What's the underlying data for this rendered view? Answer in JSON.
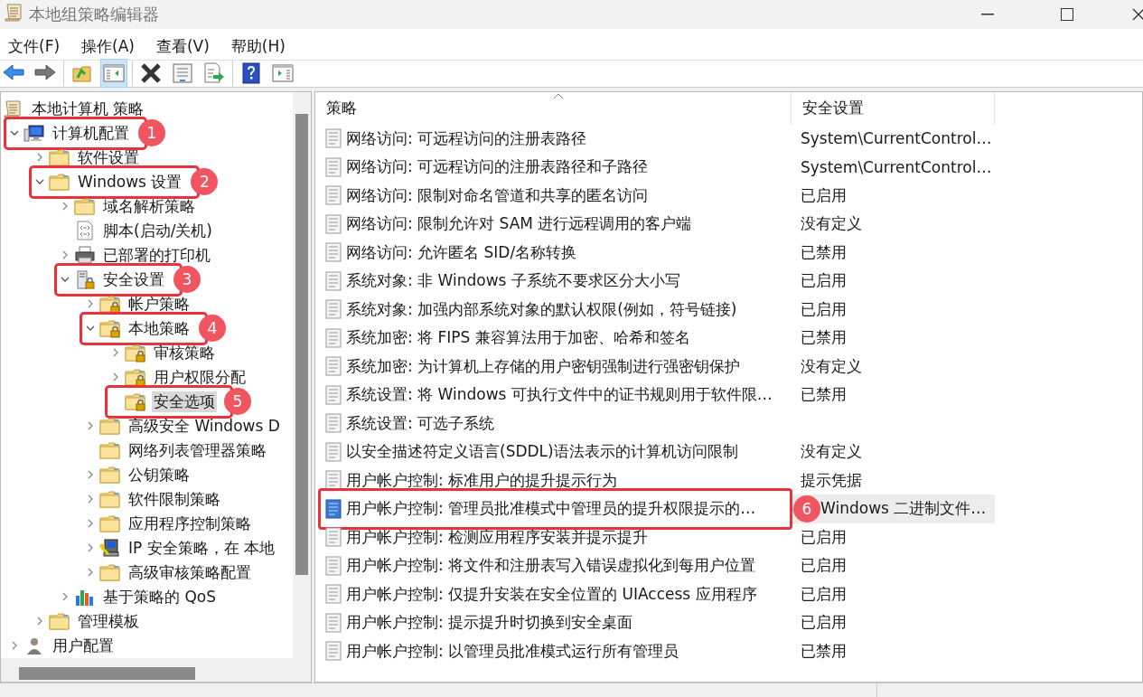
{
  "window": {
    "title": "本地组策略编辑器"
  },
  "menu": [
    {
      "label": "文件(F)"
    },
    {
      "label": "操作(A)"
    },
    {
      "label": "查看(V)"
    },
    {
      "label": "帮助(H)"
    }
  ],
  "toolbar": [
    [
      {
        "kind": "back",
        "pressed": false
      },
      {
        "kind": "forward",
        "pressed": false
      }
    ],
    [
      {
        "kind": "up",
        "pressed": false
      },
      {
        "kind": "tree",
        "pressed": true
      }
    ],
    [
      {
        "kind": "delete",
        "pressed": false
      },
      {
        "kind": "properties",
        "pressed": false
      },
      {
        "kind": "export",
        "pressed": false
      }
    ],
    [
      {
        "kind": "help",
        "pressed": false
      },
      {
        "kind": "actions",
        "pressed": false
      }
    ]
  ],
  "tree": [
    {
      "label": "本地计算机 策略",
      "kind": "scroll",
      "selected": false,
      "children": [
        {
          "label": "计算机配置",
          "kind": "computer",
          "expanded": true,
          "selected": false,
          "callout": "1",
          "children": [
            {
              "label": "软件设置",
              "kind": "folder",
              "expanded": false,
              "selected": false
            },
            {
              "label": "Windows 设置",
              "kind": "folder",
              "expanded": true,
              "selected": false,
              "callout": "2",
              "children": [
                {
                  "label": "域名解析策略",
                  "kind": "folder",
                  "expanded": false,
                  "selected": false
                },
                {
                  "label": "脚本(启动/关机)",
                  "kind": "script",
                  "selected": false
                },
                {
                  "label": "已部署的打印机",
                  "kind": "printer",
                  "expanded": false,
                  "selected": false
                },
                {
                  "label": "安全设置",
                  "kind": "server",
                  "expanded": true,
                  "selected": false,
                  "callout": "3",
                  "children": [
                    {
                      "label": "帐户策略",
                      "kind": "secure",
                      "expanded": false,
                      "selected": false
                    },
                    {
                      "label": "本地策略",
                      "kind": "secure",
                      "expanded": true,
                      "selected": false,
                      "callout": "4",
                      "children": [
                        {
                          "label": "审核策略",
                          "kind": "secure",
                          "expanded": false,
                          "selected": false
                        },
                        {
                          "label": "用户权限分配",
                          "kind": "secure",
                          "expanded": false,
                          "selected": false
                        },
                        {
                          "label": "安全选项",
                          "kind": "secure",
                          "selected": true,
                          "callout": "5"
                        }
                      ]
                    },
                    {
                      "label": "高级安全 Windows D",
                      "kind": "folder",
                      "expanded": false,
                      "selected": false
                    },
                    {
                      "label": "网络列表管理器策略",
                      "kind": "folder",
                      "selected": false
                    },
                    {
                      "label": "公钥策略",
                      "kind": "folder",
                      "expanded": false,
                      "selected": false
                    },
                    {
                      "label": "软件限制策略",
                      "kind": "folder",
                      "expanded": false,
                      "selected": false
                    },
                    {
                      "label": "应用程序控制策略",
                      "kind": "folder",
                      "expanded": false,
                      "selected": false
                    },
                    {
                      "label": "IP 安全策略，在 本地",
                      "kind": "ip",
                      "expanded": false,
                      "selected": false
                    },
                    {
                      "label": "高级审核策略配置",
                      "kind": "folder",
                      "expanded": false,
                      "selected": false
                    }
                  ]
                },
                {
                  "label": "基于策略的 QoS",
                  "kind": "qos",
                  "expanded": false,
                  "selected": false
                }
              ]
            },
            {
              "label": "管理模板",
              "kind": "folder",
              "expanded": false,
              "selected": false
            }
          ]
        },
        {
          "label": "用户配置",
          "kind": "user",
          "expanded": false,
          "selected": false
        }
      ]
    }
  ],
  "table": {
    "columns": [
      {
        "label": "策略",
        "sorted": true
      },
      {
        "label": "安全设置",
        "sorted": false
      }
    ],
    "rows": [
      {
        "policy": "网络访问: 可远程访问的注册表路径",
        "setting": "System\\CurrentControl…",
        "selected": false
      },
      {
        "policy": "网络访问: 可远程访问的注册表路径和子路径",
        "setting": "System\\CurrentControl…",
        "selected": false
      },
      {
        "policy": "网络访问: 限制对命名管道和共享的匿名访问",
        "setting": "已启用",
        "selected": false
      },
      {
        "policy": "网络访问: 限制允许对 SAM 进行远程调用的客户端",
        "setting": "没有定义",
        "selected": false
      },
      {
        "policy": "网络访问: 允许匿名 SID/名称转换",
        "setting": "已禁用",
        "selected": false
      },
      {
        "policy": "系统对象: 非 Windows 子系统不要求区分大小写",
        "setting": "已启用",
        "selected": false
      },
      {
        "policy": "系统对象: 加强内部系统对象的默认权限(例如，符号链接)",
        "setting": "已启用",
        "selected": false
      },
      {
        "policy": "系统加密: 将 FIPS 兼容算法用于加密、哈希和签名",
        "setting": "已禁用",
        "selected": false
      },
      {
        "policy": "系统加密: 为计算机上存储的用户密钥强制进行强密钥保护",
        "setting": "没有定义",
        "selected": false
      },
      {
        "policy": "系统设置: 将 Windows 可执行文件中的证书规则用于软件限…",
        "setting": "已禁用",
        "selected": false
      },
      {
        "policy": "系统设置: 可选子系统",
        "selected": false
      },
      {
        "policy": "以安全描述符定义语言(SDDL)语法表示的计算机访问限制",
        "setting": "没有定义",
        "selected": false
      },
      {
        "policy": "用户帐户控制: 标准用户的提升提示行为",
        "setting": "提示凭据",
        "selected": false
      },
      {
        "policy": "用户帐户控制: 管理员批准模式中管理员的提升权限提示的…",
        "setting": "Windows 二进制文件…",
        "selected": true,
        "callout": "6"
      },
      {
        "policy": "用户帐户控制: 检测应用程序安装并提示提升",
        "setting": "已启用",
        "selected": false
      },
      {
        "policy": "用户帐户控制: 将文件和注册表写入错误虚拟化到每用户位置",
        "setting": "已启用",
        "selected": false
      },
      {
        "policy": "用户帐户控制: 仅提升安装在安全位置的 UIAccess 应用程序",
        "setting": "已启用",
        "selected": false
      },
      {
        "policy": "用户帐户控制: 提示提升时切换到安全桌面",
        "setting": "已启用",
        "selected": false
      },
      {
        "policy": "用户帐户控制: 以管理员批准模式运行所有管理员",
        "setting": "已禁用",
        "selected": false
      }
    ]
  }
}
